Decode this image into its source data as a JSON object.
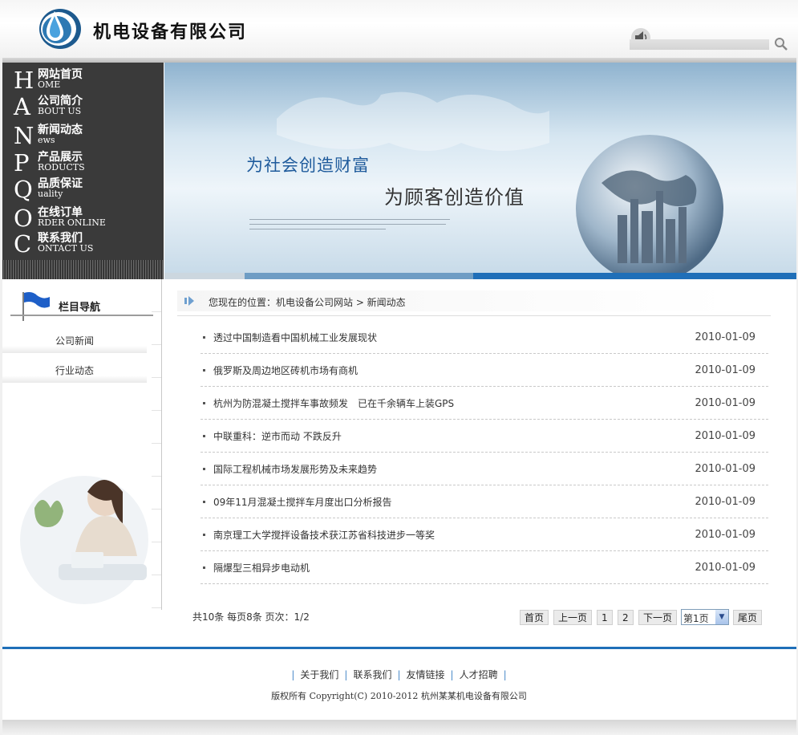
{
  "header": {
    "company_name": "机电设备有限公司"
  },
  "nav": [
    {
      "big": "H",
      "cn": "网站首页",
      "en": "OME"
    },
    {
      "big": "A",
      "cn": "公司简介",
      "en": "BOUT US"
    },
    {
      "big": "N",
      "cn": "新闻动态",
      "en": "ews"
    },
    {
      "big": "P",
      "cn": "产品展示",
      "en": "RODUCTS"
    },
    {
      "big": "Q",
      "cn": "品质保证",
      "en": "uality"
    },
    {
      "big": "O",
      "cn": "在线订单",
      "en": "RDER ONLINE"
    },
    {
      "big": "C",
      "cn": "联系我们",
      "en": "ONTACT US"
    }
  ],
  "banner": {
    "slogan1": "为社会创造财富",
    "slogan2": "为顾客创造价值"
  },
  "sidebar": {
    "title": "栏目导航",
    "links": [
      "公司新闻",
      "行业动态"
    ]
  },
  "breadcrumb": {
    "text": "您现在的位置：机电设备公司网站  > 新闻动态"
  },
  "news": [
    {
      "title": "透过中国制造看中国机械工业发展现状",
      "date": "2010-01-09"
    },
    {
      "title": "俄罗斯及周边地区砖机市场有商机",
      "date": "2010-01-09"
    },
    {
      "title": "杭州为防混凝土搅拌车事故频发　已在千余辆车上装GPS",
      "date": "2010-01-09"
    },
    {
      "title": "中联重科：逆市而动 不跌反升",
      "date": "2010-01-09"
    },
    {
      "title": "国际工程机械市场发展形势及未来趋势",
      "date": "2010-01-09"
    },
    {
      "title": "09年11月混凝土搅拌车月度出口分析报告",
      "date": "2010-01-09"
    },
    {
      "title": "南京理工大学搅拌设备技术获江苏省科技进步一等奖",
      "date": "2010-01-09"
    },
    {
      "title": "隔爆型三相异步电动机",
      "date": "2010-01-09"
    }
  ],
  "pager": {
    "info": "共10条  每页8条  页次：1/2",
    "first": "首页",
    "prev": "上一页",
    "page1": "1",
    "page2": "2",
    "next": "下一页",
    "select_value": "第1页",
    "last": "尾页"
  },
  "footer": {
    "sep": "|",
    "links": [
      "关于我们",
      "联系我们",
      "友情链接",
      "人才招聘"
    ],
    "copyright": "版权所有 Copyright(C) 2010-2012  杭州某某机电设备有限公司"
  },
  "colors": {
    "accent": "#1f6fb8",
    "nav_bg": "#3a3a3a"
  }
}
